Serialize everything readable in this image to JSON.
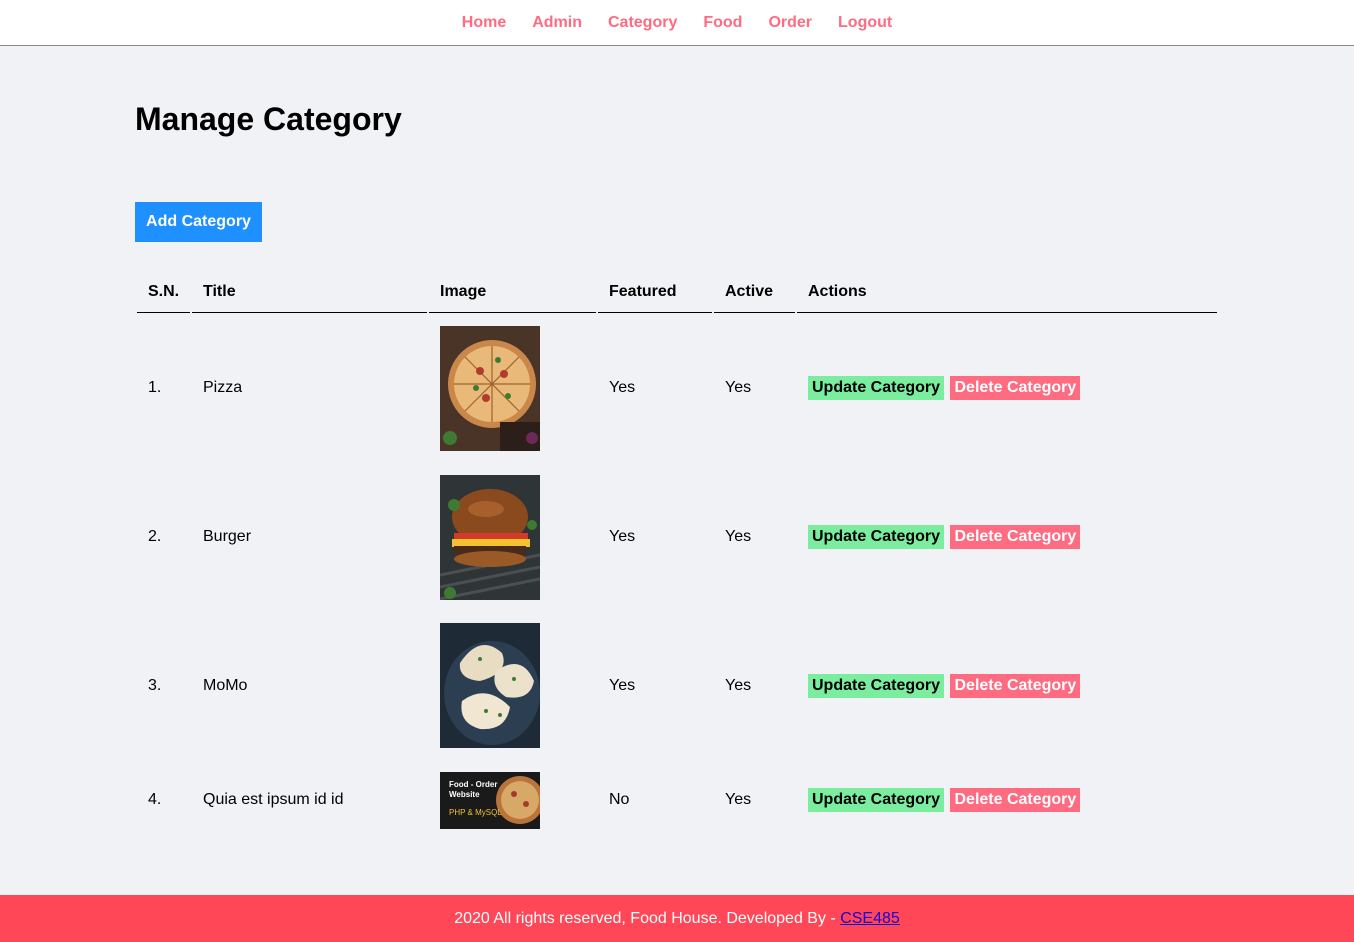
{
  "nav": {
    "items": [
      {
        "label": "Home"
      },
      {
        "label": "Admin"
      },
      {
        "label": "Category"
      },
      {
        "label": "Food"
      },
      {
        "label": "Order"
      },
      {
        "label": "Logout"
      }
    ]
  },
  "page": {
    "title": "Manage Category",
    "add_button": "Add Category"
  },
  "table": {
    "headers": [
      "S.N.",
      "Title",
      "Image",
      "Featured",
      "Active",
      "Actions"
    ],
    "rows": [
      {
        "sn": "1.",
        "title": "Pizza",
        "image": "pizza-image",
        "featured": "Yes",
        "active": "Yes",
        "update": "Update Category",
        "delete": "Delete Category"
      },
      {
        "sn": "2.",
        "title": "Burger",
        "image": "burger-image",
        "featured": "Yes",
        "active": "Yes",
        "update": "Update Category",
        "delete": "Delete Category"
      },
      {
        "sn": "3.",
        "title": "MoMo",
        "image": "momo-image",
        "featured": "Yes",
        "active": "Yes",
        "update": "Update Category",
        "delete": "Delete Category"
      },
      {
        "sn": "4.",
        "title": "Quia est ipsum id id",
        "image": "food-order-banner-image",
        "image_text_1": "Food - Order",
        "image_text_2": "Website",
        "image_text_3": "PHP & MySQL",
        "featured": "No",
        "active": "Yes",
        "update": "Update Category",
        "delete": "Delete Category"
      }
    ]
  },
  "footer": {
    "text": "2020 All rights reserved, Food House. Developed By - ",
    "link": "CSE485"
  },
  "colors": {
    "nav_link": "#ff6b81",
    "primary_button": "#1e90ff",
    "update_button": "#7bed9f",
    "delete_button": "#ff6b81",
    "footer_bg": "#ff4757",
    "page_bg": "#f1f2f6"
  }
}
